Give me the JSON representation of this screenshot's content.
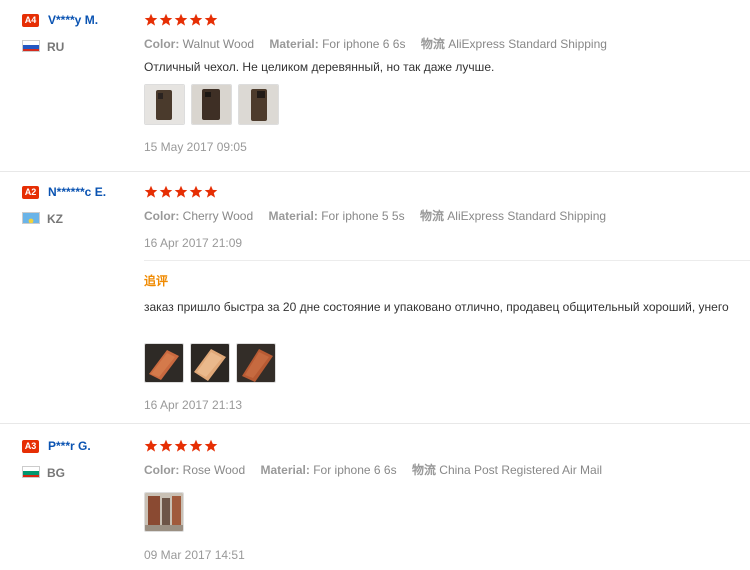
{
  "reviews": [
    {
      "badge": "A4",
      "name": "V****y M.",
      "country": "RU",
      "rating": 5,
      "color_label": "Color:",
      "color": "Walnut Wood",
      "material_label": "Material:",
      "material": "For iphone 6 6s",
      "shipping_label": "物流",
      "shipping": "AliExpress Standard Shipping",
      "text": "Отличный чехол. Не целиком деревянный, но так даже лучше.",
      "date": "15 May 2017 09:05"
    },
    {
      "badge": "A2",
      "name": "N******c E.",
      "country": "KZ",
      "rating": 5,
      "color_label": "Color:",
      "color": "Cherry Wood",
      "material_label": "Material:",
      "material": "For iphone 5 5s",
      "shipping_label": "物流",
      "shipping": "AliExpress Standard Shipping",
      "date": "16 Apr 2017 21:09",
      "additional_label": "追评",
      "additional_text": "заказ пришло быстра за 20 дне состояние и упаковано отлично, продавец общительный хороший, унего",
      "additional_date": "16 Apr 2017 21:13"
    },
    {
      "badge": "A3",
      "name": "P***r G.",
      "country": "BG",
      "rating": 5,
      "color_label": "Color:",
      "color": "Rose Wood",
      "material_label": "Material:",
      "material": "For iphone 6 6s",
      "shipping_label": "物流",
      "shipping": "China Post Registered Air Mail",
      "date": "09 Mar 2017 14:51"
    }
  ],
  "colors": {
    "badge": "#e62e04",
    "name": "#0a53b2",
    "star": "#e62e04",
    "additional": "#f08a00"
  }
}
